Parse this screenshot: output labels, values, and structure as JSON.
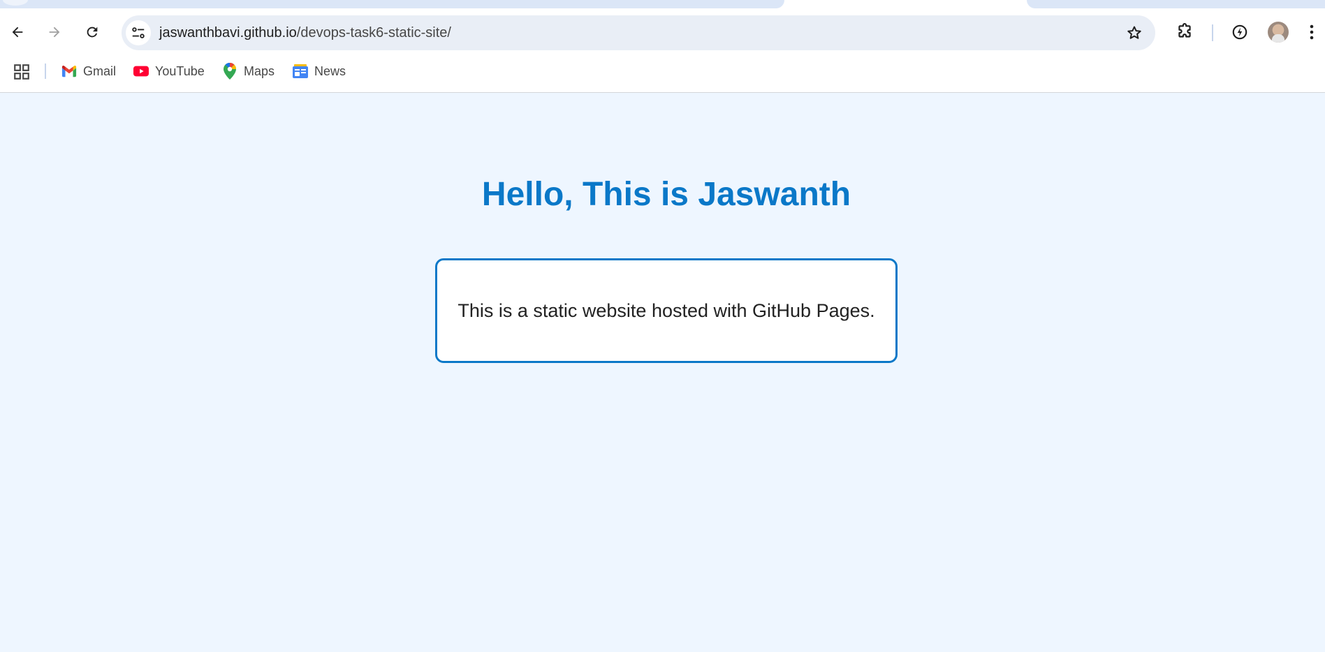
{
  "browser": {
    "url_host": "jaswanthbavi.github.io",
    "url_path": "/devops-task6-static-site/",
    "bookmarks": [
      {
        "label": "Gmail",
        "icon": "gmail-icon"
      },
      {
        "label": "YouTube",
        "icon": "youtube-icon"
      },
      {
        "label": "Maps",
        "icon": "maps-icon"
      },
      {
        "label": "News",
        "icon": "news-icon"
      }
    ]
  },
  "page": {
    "heading": "Hello, This is Jaswanth",
    "card_text": "This is a static website hosted with GitHub Pages."
  },
  "colors": {
    "page_background": "#eef6ff",
    "accent": "#0a78c8",
    "card_background": "#ffffff",
    "omnibox_background": "#e9eef6"
  }
}
